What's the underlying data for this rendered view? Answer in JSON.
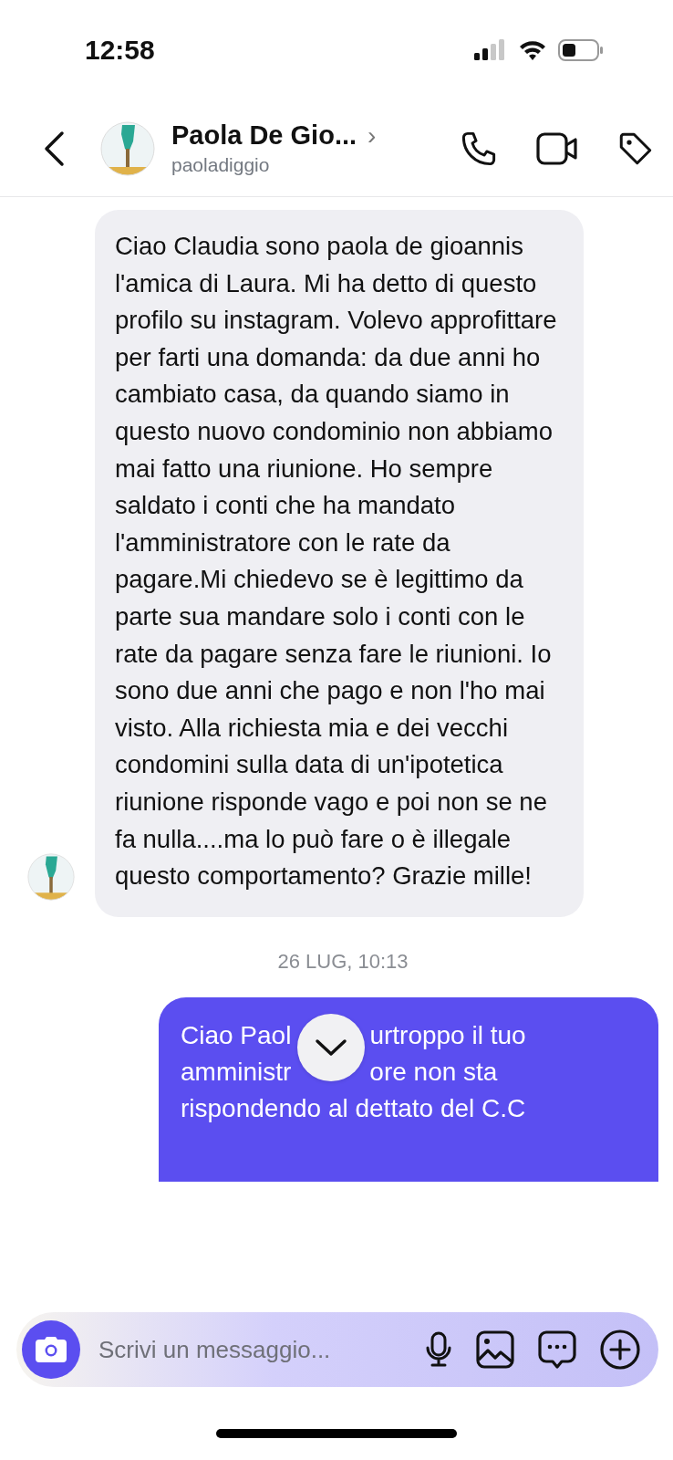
{
  "status_bar": {
    "time": "12:58"
  },
  "header": {
    "name": "Paola De Gio...",
    "chevron": "›",
    "username": "paoladiggio"
  },
  "messages": [
    {
      "kind": "received",
      "text": "Ciao Claudia sono paola de gioannis l'amica di Laura. Mi ha detto di questo profilo su instagram. Volevo approfittare per farti una domanda: da due anni ho cambiato casa, da quando siamo in questo nuovo condominio non abbiamo mai fatto una riunione. Ho sempre saldato i conti che ha mandato l'amministratore con le rate da pagare.Mi chiedevo se è legittimo da parte sua mandare solo i conti con le rate da pagare senza fare le riunioni. Io sono due anni che pago e non l'ho mai visto. Alla richiesta mia e dei vecchi condomini sulla data di un'ipotetica riunione risponde vago e poi non se ne fa nulla....ma lo può fare o è illegale questo comportamento? Grazie mille!"
    },
    {
      "kind": "timestamp",
      "text": "26 LUG, 10:13"
    },
    {
      "kind": "sent",
      "lines": [
        [
          "Ciao Paol",
          "urtroppo il tuo"
        ],
        [
          "amministr",
          "ore non sta"
        ],
        [
          "rispondendo al dettato del C.C"
        ]
      ]
    }
  ],
  "composer": {
    "placeholder": "Scrivi un messaggio..."
  }
}
